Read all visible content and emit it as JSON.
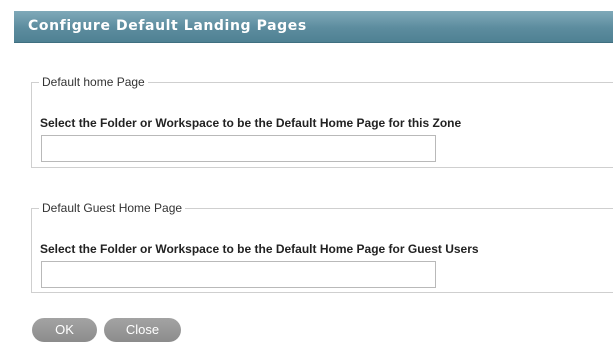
{
  "dialog": {
    "title": "Configure Default Landing Pages",
    "title_bar_color": "#5c8c9e"
  },
  "home_page": {
    "legend": "Default home Page",
    "prompt": "Select the Folder or Workspace to be the Default Home Page for this Zone",
    "value": ""
  },
  "guest_page": {
    "legend": "Default Guest Home Page",
    "prompt": "Select the Folder or Workspace to be the Default Home Page for Guest Users",
    "value": ""
  },
  "buttons": {
    "ok_label": "OK",
    "close_label": "Close",
    "button_color": "#999999"
  }
}
